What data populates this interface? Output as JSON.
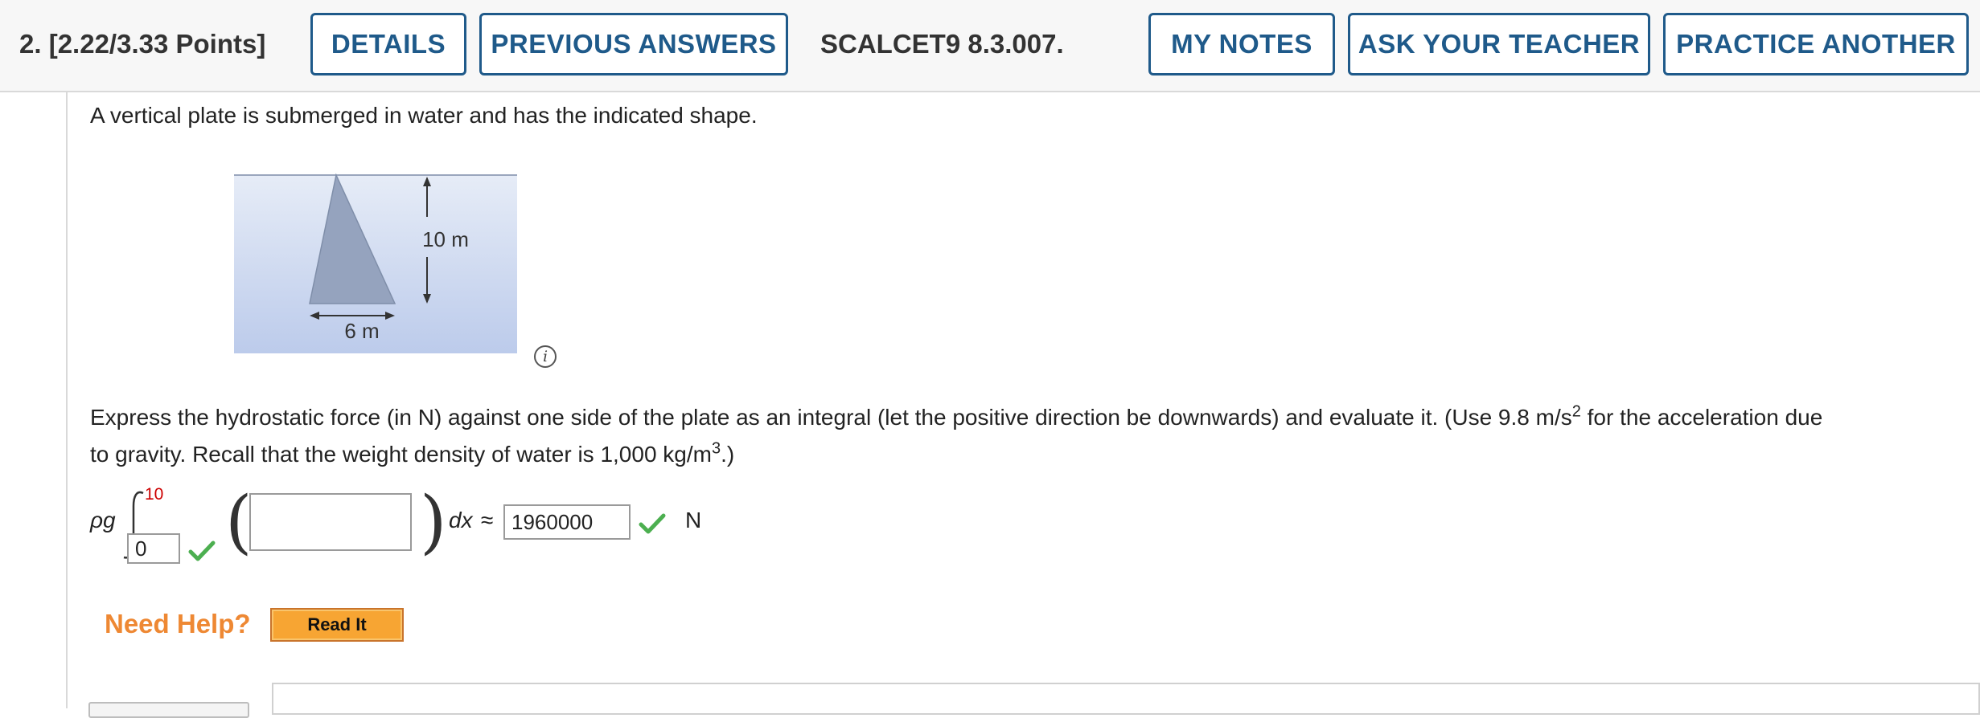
{
  "header": {
    "question_number": "2.",
    "points": "[2.22/3.33 Points]",
    "details_label": "DETAILS",
    "previous_answers_label": "PREVIOUS ANSWERS",
    "problem_code": "SCALCET9 8.3.007.",
    "my_notes_label": "MY NOTES",
    "ask_teacher_label": "ASK YOUR TEACHER",
    "practice_another_label": "PRACTICE ANOTHER"
  },
  "prompt": {
    "intro": "A vertical plate is submerged in water and has the indicated shape.",
    "figure": {
      "height_label": "10 m",
      "base_label": "6 m"
    },
    "instruction_line1_a": "Express the hydrostatic force (in N) against one side of the plate as an integral (let the positive direction be downwards) and evaluate it. (Use 9.8 m/s",
    "instruction_line1_sup": "2",
    "instruction_line1_b": " for the acceleration due",
    "instruction_line2_a": "to gravity. Recall that the weight density of water is 1,000 kg/m",
    "instruction_line2_sup": "3",
    "instruction_line2_b": ".)"
  },
  "answer": {
    "rho_g": "ρg",
    "upper_limit": "10",
    "lower_limit_value": "0",
    "integrand_value": "",
    "dx": "dx",
    "approx": "≈",
    "result_value": "1960000",
    "unit": "N"
  },
  "help": {
    "need_help_label": "Need Help?",
    "read_it_label": "Read It"
  },
  "colors": {
    "accent": "#1f5a8a",
    "correct_check": "#4caf50",
    "limit_red": "#cc0000",
    "help_orange": "#ee8833"
  }
}
